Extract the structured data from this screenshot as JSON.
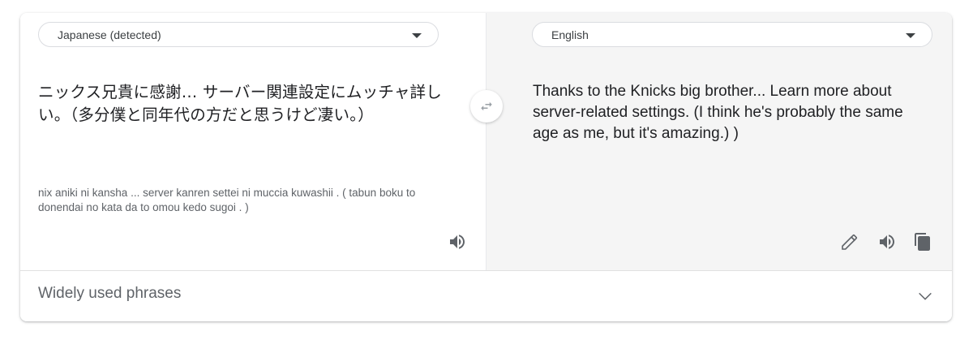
{
  "source": {
    "language_label": "Japanese (detected)",
    "text": "ニックス兄貴に感謝… サーバー関連設定にムッチャ詳しい。（多分僕と同年代の方だと思うけど凄い。）",
    "romanization": "nix aniki ni kansha ... server kanren settei ni muccia kuwashii . ( tabun boku to donendai no kata da to omou kedo sugoi . )",
    "speak_icon": "speaker-icon"
  },
  "target": {
    "language_label": "English",
    "text": "Thanks to the Knicks big brother... Learn more about server-related settings. (I think he's probably the same age as me, but it's amazing.) )",
    "edit_icon": "pencil-icon",
    "speak_icon": "speaker-icon",
    "copy_icon": "copy-icon"
  },
  "swap": {
    "icon": "swap-arrows-icon"
  },
  "phrases": {
    "label": "Widely used phrases",
    "icon": "chevron-down-icon"
  },
  "colors": {
    "target_pane_bg": "#f5f5f5",
    "icon_gray": "#5f6368",
    "text_dark": "#202124"
  }
}
